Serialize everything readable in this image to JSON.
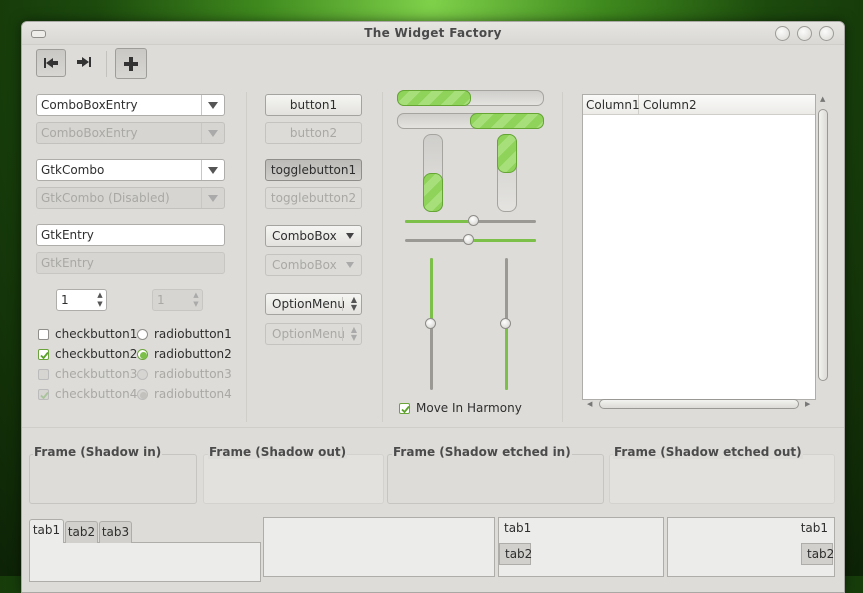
{
  "window": {
    "title": "The Widget Factory"
  },
  "toolbar": {
    "first_icon": "skip-previous-icon",
    "last_icon": "skip-next-icon",
    "add_icon": "add-icon"
  },
  "left": {
    "combobox_entry": "ComboBoxEntry",
    "combobox_entry_disabled": "ComboBoxEntry",
    "gtkcombo": "GtkCombo",
    "gtkcombo_disabled": "GtkCombo (Disabled)",
    "entry": "GtkEntry",
    "entry_disabled_placeholder": "GtkEntry",
    "spin_value": "1",
    "spin_disabled_value": "1",
    "checks": [
      {
        "label": "checkbutton1",
        "checked": false,
        "disabled": false
      },
      {
        "label": "checkbutton2",
        "checked": true,
        "disabled": false
      },
      {
        "label": "checkbutton3",
        "checked": false,
        "disabled": true
      },
      {
        "label": "checkbutton4",
        "checked": true,
        "disabled": true
      }
    ],
    "radios": [
      {
        "label": "radiobutton1",
        "selected": false,
        "disabled": false
      },
      {
        "label": "radiobutton2",
        "selected": true,
        "disabled": false
      },
      {
        "label": "radiobutton3",
        "selected": false,
        "disabled": true
      },
      {
        "label": "radiobutton4",
        "selected": true,
        "disabled": true
      }
    ]
  },
  "buttons": {
    "button1": "button1",
    "button2": "button2",
    "toggle1": "togglebutton1",
    "toggle2": "togglebutton2",
    "combobox": "ComboBox",
    "combobox_disabled": "ComboBox",
    "optionmenu": "OptionMenu",
    "optionmenu_disabled": "OptionMenu"
  },
  "ranges": {
    "hprogress1": 0.5,
    "hprogress2": 0.5,
    "vprogress1": 0.5,
    "vprogress2": 0.5,
    "hscale1": 0.53,
    "hscale2": 0.49,
    "vscale1": 0.5,
    "vscale2": 0.5,
    "move_in_harmony": "Move In Harmony"
  },
  "tree": {
    "columns": [
      "Column1",
      "Column2"
    ]
  },
  "frames": {
    "shadow_in": "Frame (Shadow in)",
    "shadow_out": "Frame (Shadow out)",
    "etched_in": "Frame (Shadow etched in)",
    "etched_out": "Frame (Shadow etched out)"
  },
  "notebooks": {
    "top_tabs": [
      "tab1",
      "tab2",
      "tab3"
    ],
    "left_tabs": [
      "tab1",
      "tab2"
    ],
    "right_tabs": [
      "tab1",
      "tab2"
    ]
  },
  "colors": {
    "accent": "#7cc04a",
    "window_bg": "#dddcd8"
  }
}
